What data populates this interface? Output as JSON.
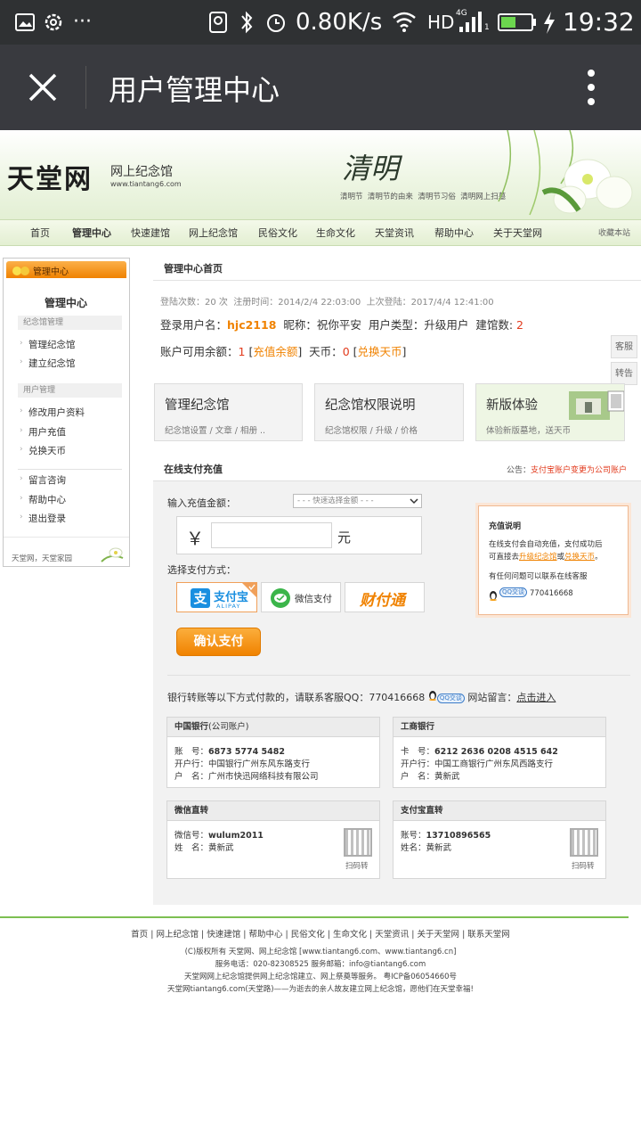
{
  "status_bar": {
    "network_speed": "0.80K/s",
    "hd": "HD",
    "net_type": "4G",
    "time": "19:32",
    "more": "···",
    "sim": "1"
  },
  "wechat_bar": {
    "title": "用户管理中心"
  },
  "banner": {
    "logo": "天堂网",
    "subtitle": "网上纪念馆",
    "url": "www.tiantang6.com",
    "qingming_calligraphy": "清明",
    "links": [
      "清明节",
      "清明节的由来",
      "清明节习俗",
      "清明网上扫墓"
    ]
  },
  "nav": {
    "items": [
      "首页",
      "管理中心",
      "快速建馆",
      "网上纪念馆",
      "民俗文化",
      "生命文化",
      "天堂资讯",
      "帮助中心",
      "关于天堂网"
    ],
    "bookmark": "收藏本站"
  },
  "sidebar": {
    "tab": "管理中心",
    "title": "管理中心",
    "group1": "纪念馆管理",
    "group1_items": [
      "管理纪念馆",
      "建立纪念馆"
    ],
    "group2": "用户管理",
    "group2_items": [
      "修改用户资料",
      "用户充值",
      "兑换天币"
    ],
    "group3_items": [
      "留言咨询",
      "帮助中心",
      "退出登录"
    ],
    "footer": "天堂网，天堂家园"
  },
  "main": {
    "header": "管理中心首页",
    "login_info": {
      "count_label": "登陆次数：",
      "count": "20",
      "count_unit": "次",
      "reg_label": "注册时间：",
      "reg_time": "2014/2/4 22:03:00",
      "last_label": "上次登陆：",
      "last_time": "2017/4/4 12:41:00"
    },
    "user": {
      "name_label": "登录用户名：",
      "name": "hjc2118",
      "nick_label": "昵称：",
      "nick": "祝你平安",
      "type_label": "用户类型：",
      "type": "升级用户",
      "count_label": "建馆数:",
      "count": "2"
    },
    "balance": {
      "label": "账户可用余额：",
      "value": "1",
      "recharge": "充值余额",
      "coin_label": "天币：",
      "coin": "0",
      "exchange": "兑换天币"
    },
    "side_tabs": [
      "客服",
      "转告"
    ],
    "cards": [
      {
        "title": "管理纪念馆",
        "desc": "纪念馆设置 / 文章 / 相册 .."
      },
      {
        "title": "纪念馆权限说明",
        "desc": "纪念馆权限 / 升级 / 价格"
      },
      {
        "title": "新版体验",
        "desc": "体验新版墓地，送天币"
      }
    ]
  },
  "pay": {
    "title": "在线支付充值",
    "notice_label": "公告：",
    "notice": "支付宝账户变更为公司账户",
    "amount_label": "输入充值金额：",
    "quick_select": "- - - 快速选择金额 - - -",
    "currency": "￥",
    "amount_value": "",
    "unit": "元",
    "method_label": "选择支付方式：",
    "methods": [
      {
        "name": "支付宝",
        "sub": "ALIPAY"
      },
      {
        "name": "微信支付"
      },
      {
        "name": "财付通"
      }
    ],
    "confirm": "确认支付",
    "info_box": {
      "title": "充值说明",
      "line1": "在线支付会自动充值，支付成功后",
      "line2_pre": "可直接去",
      "line2_link1": "升级纪念馆",
      "line2_mid": "或",
      "line2_link2": "兑换天币",
      "line2_end": "。",
      "line3": "有任何问题可以联系在线客服",
      "qq_badge": "QQ交谈",
      "qq": "770416668"
    }
  },
  "bank_transfer": {
    "text": "银行转账等以下方式付款的，请联系客服QQ：770416668",
    "qq_badge": "QQ交谈",
    "msg_label": "网站留言：",
    "msg_link": "点击进入",
    "boc": {
      "title": "中国银行",
      "title_sub": "(公司账户)",
      "acct_label": "账　号：",
      "acct": "6873 5774 5482",
      "branch_label": "开户行：",
      "branch": "中国银行广州东风东路支行",
      "owner_label": "户　名：",
      "owner": "广州市快迅网络科技有限公司"
    },
    "icbc": {
      "title": "工商银行",
      "acct_label": "卡　号：",
      "acct": "6212 2636 0208 4515 642",
      "branch_label": "开户行：",
      "branch": "中国工商银行广州东风西路支行",
      "owner_label": "户　名：",
      "owner": "黄新武"
    },
    "wechat": {
      "title": "微信直转",
      "id_label": "微信号：",
      "id": "wulum2011",
      "name_label": "姓　名：",
      "name": "黄新武",
      "scan": "扫码转"
    },
    "alipay": {
      "title": "支付宝直转",
      "id_label": "账号：",
      "id": "13710896565",
      "name_label": "姓名：",
      "name": "黄新武",
      "scan": "扫码转"
    }
  },
  "footer": {
    "links": [
      "首页",
      "网上纪念馆",
      "快速建馆",
      "帮助中心",
      "民俗文化",
      "生命文化",
      "天堂资讯",
      "关于天堂网",
      "联系天堂网"
    ],
    "copyright": "(C)版权所有 天堂网、网上纪念馆 [www.tiantang6.com、www.tiantang6.cn]",
    "service": "服务电话：020-82308525  服务邮箱：info@tiantang6.com",
    "icp": "天堂网网上纪念馆提供网上纪念馆建立、网上祭奠等服务。 粤ICP备06054660号",
    "slogan": "天堂网tiantang6.com(天堂路)——为逝去的亲人故友建立网上纪念馆，愿他们在天堂幸福!"
  },
  "colors": {
    "status_bg": "#2f3133",
    "wechat_bg": "#393a3f",
    "accent_orange": "#f08200",
    "red": "#e23a1c",
    "button_orange": "#f7931e"
  }
}
